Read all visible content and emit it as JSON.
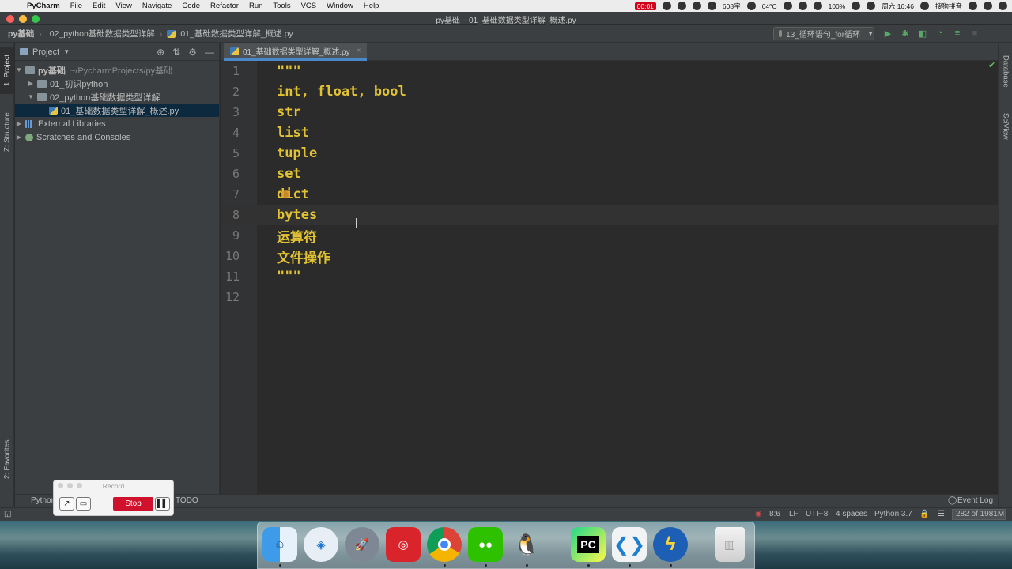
{
  "menubar": {
    "app_name": "PyCharm",
    "items": [
      "File",
      "Edit",
      "View",
      "Navigate",
      "Code",
      "Refactor",
      "Run",
      "Tools",
      "VCS",
      "Window",
      "Help"
    ],
    "status": {
      "record_time": "00:01",
      "word_count": "608字",
      "temp": "64°C",
      "battery": "100%",
      "clock": "周六 16:46",
      "input_method": "搜狗拼音"
    }
  },
  "window": {
    "title": "py基础 – 01_基础数据类型详解_概述.py"
  },
  "navbar": {
    "breadcrumbs": [
      "py基础",
      "02_python基础数据类型详解",
      "01_基础数据类型详解_概述.py"
    ],
    "run_config": "13_循环语句_for循环"
  },
  "left_strip": {
    "project_tab": "1: Project",
    "structure_tab": "Z: Structure",
    "favorites_tab": "2: Favorites"
  },
  "right_strip": {
    "database_tab": "Database",
    "sciview_tab": "SciView"
  },
  "project_panel": {
    "title": "Project",
    "tree": [
      {
        "label": "py基础",
        "extra": "~/PycharmProjects/py基础",
        "indent": 0,
        "arrow": "▼",
        "icon": "folder"
      },
      {
        "label": "01_初识python",
        "extra": "",
        "indent": 1,
        "arrow": "▶",
        "icon": "folder"
      },
      {
        "label": "02_python基础数据类型详解",
        "extra": "",
        "indent": 1,
        "arrow": "▼",
        "icon": "folder"
      },
      {
        "label": "01_基础数据类型详解_概述.py",
        "extra": "",
        "indent": 2,
        "arrow": "",
        "icon": "py"
      },
      {
        "label": "External Libraries",
        "extra": "",
        "indent": 0,
        "arrow": "▶",
        "icon": "lib"
      },
      {
        "label": "Scratches and Consoles",
        "extra": "",
        "indent": 0,
        "arrow": "▶",
        "icon": "scratch"
      }
    ]
  },
  "editor": {
    "tab_label": "01_基础数据类型详解_概述.py",
    "current_line": 8,
    "lines": [
      "\"\"\"",
      "int, float, bool",
      "str",
      "list",
      "tuple",
      "set",
      "dict",
      "bytes",
      "运算符",
      "文件操作",
      "\"\"\"",
      ""
    ]
  },
  "bottom_bar": {
    "python_console": "Python Console",
    "todo": "TODO",
    "event_log": "Event Log"
  },
  "status_bar": {
    "position": "8:6",
    "line_sep": "LF",
    "encoding": "UTF-8",
    "indent": "4 spaces",
    "interpreter": "Python 3.7",
    "memory": "282 of 1981M"
  },
  "record_widget": {
    "title": "Record",
    "stop_label": "Stop"
  },
  "dock": {
    "apps": [
      "Finder",
      "Safari",
      "Launchpad",
      "NetEase Music",
      "Chrome",
      "WeChat",
      "QQ",
      "PyCharm",
      "VS Code",
      "Thunder",
      "Trash"
    ]
  }
}
